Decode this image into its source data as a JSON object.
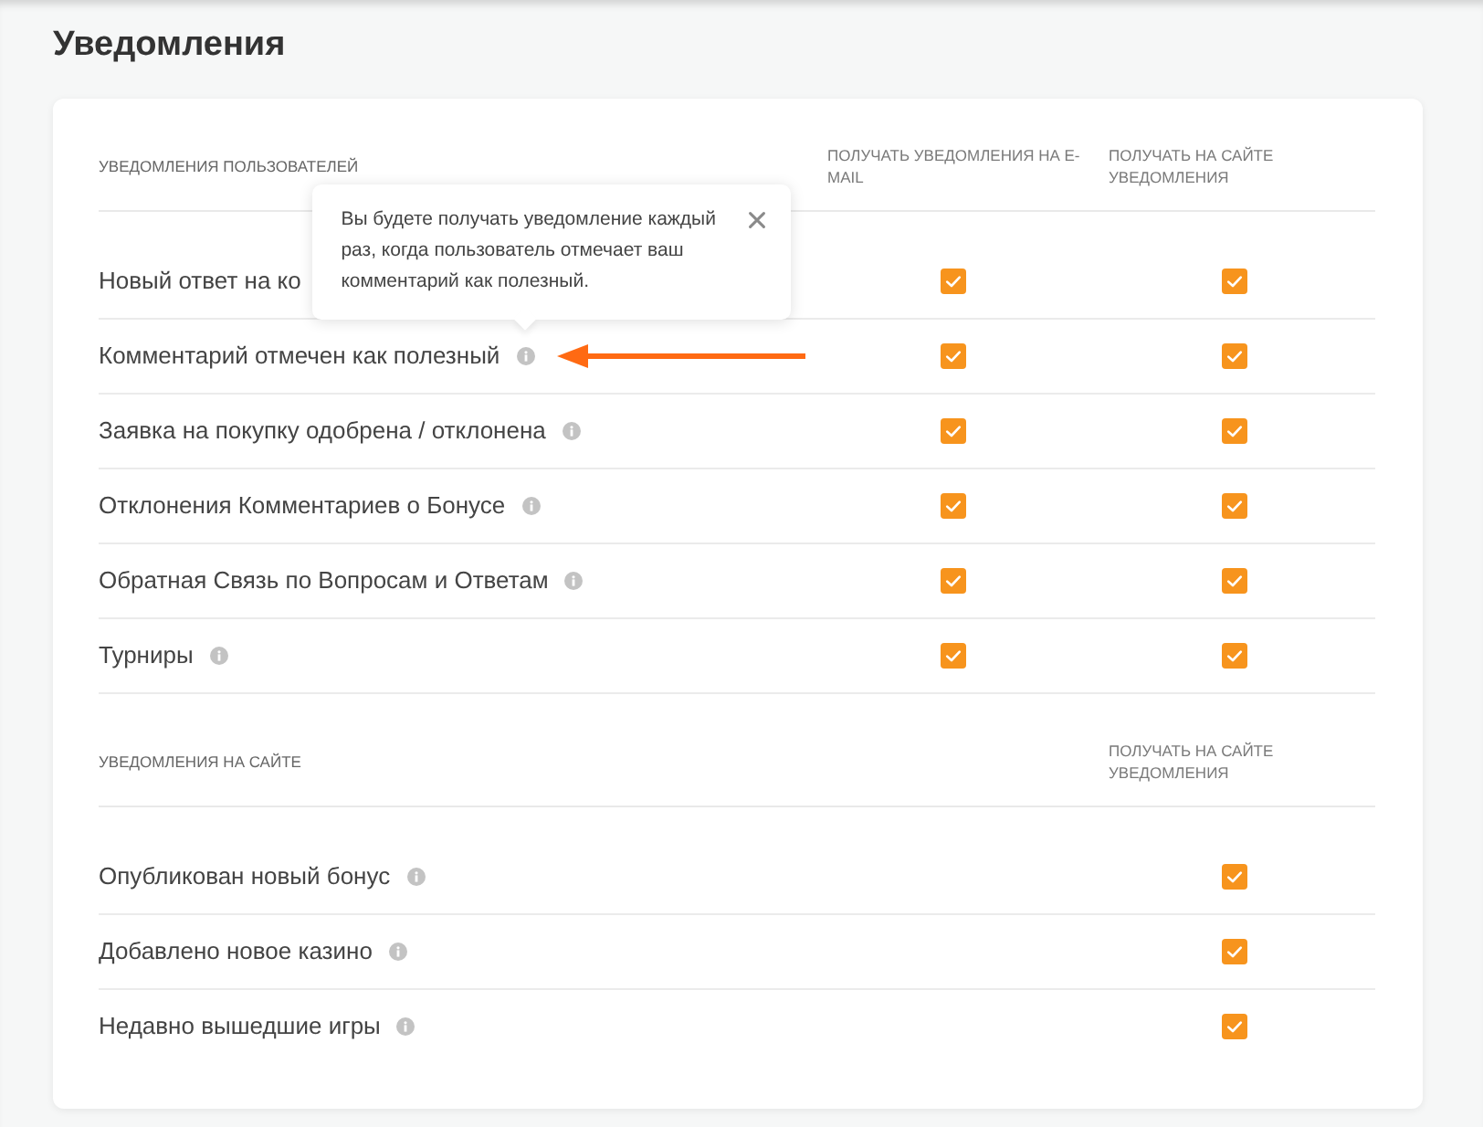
{
  "page": {
    "title": "Уведомления"
  },
  "sections": [
    {
      "title": "УВЕДОМЛЕНИЯ ПОЛЬЗОВАТЕЛЕЙ",
      "columns": [
        {
          "kind": "email",
          "label": "ПОЛУЧАТЬ УВЕДОМЛЕНИЯ НА E-MAIL"
        },
        {
          "kind": "site",
          "label": "ПОЛУЧАТЬ НА САЙТЕ УВЕДОМЛЕНИЯ"
        }
      ],
      "rows": [
        {
          "label": "Новый ответ на ко",
          "info_icon": false,
          "arrow": false,
          "email": {
            "checked": true
          },
          "site": {
            "checked": true
          }
        },
        {
          "label": "Комментарий отмечен как полезный",
          "info_icon": true,
          "tooltip": {
            "text": "Вы будете получать уведомление каждый раз, когда пользователь отмечает ваш комментарий как полезный."
          },
          "arrow": true,
          "email": {
            "checked": true
          },
          "site": {
            "checked": true
          }
        },
        {
          "label": "Заявка на покупку одобрена / отклонена",
          "info_icon": true,
          "arrow": false,
          "email": {
            "checked": true
          },
          "site": {
            "checked": true
          }
        },
        {
          "label": "Отклонения Комментариев о Бонусе",
          "info_icon": true,
          "arrow": false,
          "email": {
            "checked": true
          },
          "site": {
            "checked": true
          }
        },
        {
          "label": "Обратная Связь по Вопросам и Ответам",
          "info_icon": true,
          "arrow": false,
          "email": {
            "checked": true
          },
          "site": {
            "checked": true
          }
        },
        {
          "label": "Турниры",
          "info_icon": true,
          "arrow": false,
          "email": {
            "checked": true
          },
          "site": {
            "checked": true
          }
        }
      ]
    },
    {
      "title": "УВЕДОМЛЕНИЯ НА САЙТЕ",
      "columns": [
        {
          "kind": "site",
          "label": "ПОЛУЧАТЬ НА САЙТЕ УВЕДОМЛЕНИЯ"
        }
      ],
      "rows": [
        {
          "label": "Опубликован новый бонус",
          "info_icon": true,
          "arrow": false,
          "site": {
            "checked": true
          }
        },
        {
          "label": "Добавлено новое казино",
          "info_icon": true,
          "arrow": false,
          "site": {
            "checked": true
          }
        },
        {
          "label": "Недавно вышедшие игры",
          "info_icon": true,
          "arrow": false,
          "site": {
            "checked": true
          }
        }
      ]
    }
  ]
}
